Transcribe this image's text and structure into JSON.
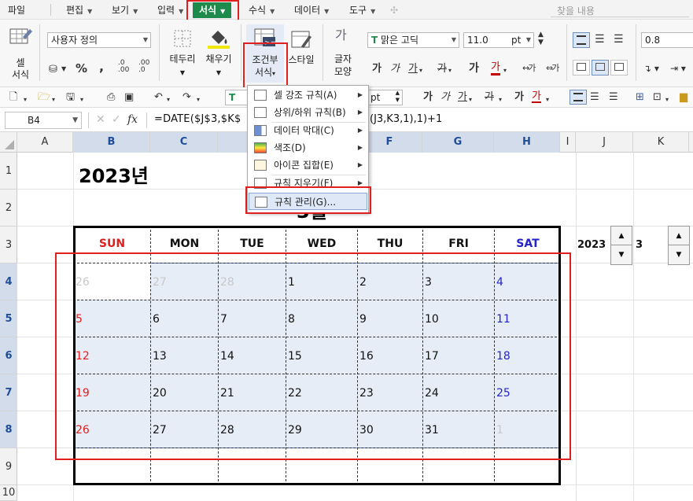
{
  "menubar": {
    "items": [
      {
        "label": "파일",
        "arrow": false
      },
      {
        "label": "편집",
        "arrow": true
      },
      {
        "label": "보기",
        "arrow": true
      },
      {
        "label": "입력",
        "arrow": true
      },
      {
        "label": "서식",
        "arrow": true,
        "active": true
      },
      {
        "label": "수식",
        "arrow": true
      },
      {
        "label": "데이터",
        "arrow": true
      },
      {
        "label": "도구",
        "arrow": true
      }
    ],
    "search_placeholder": "찾을 내용"
  },
  "ribbon": {
    "cell_format": "셀\n서식",
    "number_format": "사용자 정의",
    "percent": "%",
    "comma": ",",
    "decimal_inc": ".0\n.00",
    "decimal_dec": ".00\n.0",
    "border": "테두리",
    "fill": "채우기",
    "conditional_format_line1": "조건부",
    "conditional_format_line2": "서식",
    "style": "스타일",
    "text_shape_line1": "글자",
    "text_shape_line2": "모양",
    "font_name": "맑은 고딕",
    "font_size": "11.0",
    "font_unit": "pt",
    "line_spacing": "0.8"
  },
  "toolbar2": {
    "font_unit": "pt"
  },
  "formula_bar": {
    "name_box": "B4",
    "fx_label": "fx",
    "formula_left": "=DATE($J$3,$K$",
    "formula_right": "(J3,K3,1),1)+1"
  },
  "columns": [
    "A",
    "B",
    "C",
    "D",
    "E",
    "F",
    "G",
    "H",
    "I",
    "J",
    "K"
  ],
  "rows": [
    "1",
    "2",
    "3",
    "4",
    "5",
    "6",
    "7",
    "8",
    "9",
    "10"
  ],
  "sheet": {
    "year_title": "2023년",
    "month_title_partial": "3월",
    "weekdays": [
      {
        "label": "SUN",
        "color": "#e01e1e"
      },
      {
        "label": "MON",
        "color": "#111111"
      },
      {
        "label": "TUE",
        "color": "#111111"
      },
      {
        "label": "WED",
        "color": "#111111"
      },
      {
        "label": "THU",
        "color": "#111111"
      },
      {
        "label": "FRI",
        "color": "#111111"
      },
      {
        "label": "SAT",
        "color": "#2323c8"
      }
    ],
    "weeks": [
      [
        "26",
        "27",
        "28",
        "1",
        "2",
        "3",
        "4"
      ],
      [
        "5",
        "6",
        "7",
        "8",
        "9",
        "10",
        "11"
      ],
      [
        "12",
        "13",
        "14",
        "15",
        "16",
        "17",
        "18"
      ],
      [
        "19",
        "20",
        "21",
        "22",
        "23",
        "24",
        "25"
      ],
      [
        "26",
        "27",
        "28",
        "29",
        "30",
        "31",
        "1"
      ]
    ],
    "year_value": "2023",
    "month_value": "3",
    "colors": {
      "sunday": "#e01e1e",
      "saturday": "#2323c8",
      "weekday": "#111111",
      "faded": "#c8c8c8",
      "accent": "#1e8a4c",
      "highlight": "#e02020"
    }
  },
  "cf_menu": {
    "items": [
      {
        "label": "셀 강조 규칙(A)",
        "submenu": true
      },
      {
        "label": "상위/하위 규칙(B)",
        "submenu": true
      },
      {
        "label": "데이터 막대(C)",
        "submenu": true
      },
      {
        "label": "색조(D)",
        "submenu": true
      },
      {
        "label": "아이콘 집합(E)",
        "submenu": true
      },
      {
        "label": "규칙 지우기(F)",
        "submenu": true
      },
      {
        "label": "규칙 관리(G)...",
        "submenu": false
      }
    ]
  }
}
